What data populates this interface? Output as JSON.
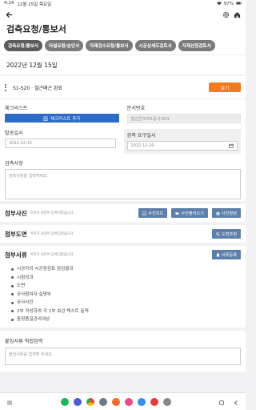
{
  "status": {
    "time": "4:24",
    "date": "12월 15일 목요일",
    "battery": "97%"
  },
  "page": {
    "title": "검측요청/통보서"
  },
  "tabs": [
    {
      "label": "검측요청/통보서",
      "active": true
    },
    {
      "label": "타설요청/승인서",
      "active": false
    },
    {
      "label": "자재검수요청/통보서",
      "active": false
    },
    {
      "label": "시공상세도검토서",
      "active": false
    },
    {
      "label": "자재선정검토서",
      "active": false
    }
  ],
  "date_header": "2022년 12월 15일",
  "step": {
    "label": "S1-S20 · 철근배근 완료",
    "view_button": "보기"
  },
  "form": {
    "checklist_label": "체크리스트",
    "checklist_button": "체크리스트 추가",
    "doc_no_label": "문서번호",
    "doc_no_placeholder": "철근콘크리트공사-001",
    "sent_date_label": "발송일시",
    "sent_date": "2022-12-15",
    "request_date_label": "검측 요구일시",
    "request_date": "2022-12-20",
    "notes_label": "검측사항",
    "notes_placeholder": "검측사항을 입력하세요."
  },
  "attach_photo": {
    "title": "첨부사진",
    "hint": "이미지 사진이 등록되었습니다.",
    "buttons": [
      "사진보드",
      "사진불러오기",
      "사진촬영"
    ]
  },
  "attach_drawing": {
    "title": "첨부도면",
    "hint": "이미지 사진이 등록되었습니다.",
    "button": "도면조회"
  },
  "attach_docs": {
    "title": "첨부서류",
    "hint": "이미지 사진이 등록되었습니다.",
    "button": "서류등록",
    "items": [
      "시공자의 시공점검표 점검결과",
      "시험성과",
      "도면",
      "공사참여자 실명부",
      "공사사진",
      "2부 작성하여 각 1부 보관 텍스트 출력",
      "충청품질관리대상"
    ]
  },
  "extra": {
    "label": "붙임서류 직접입력",
    "placeholder": "붙임서류를 입력해 주세요."
  },
  "colors": {
    "accent_orange": "#f07c1e",
    "primary_blue": "#2c6bc6",
    "steel_blue": "#5d80ab"
  }
}
